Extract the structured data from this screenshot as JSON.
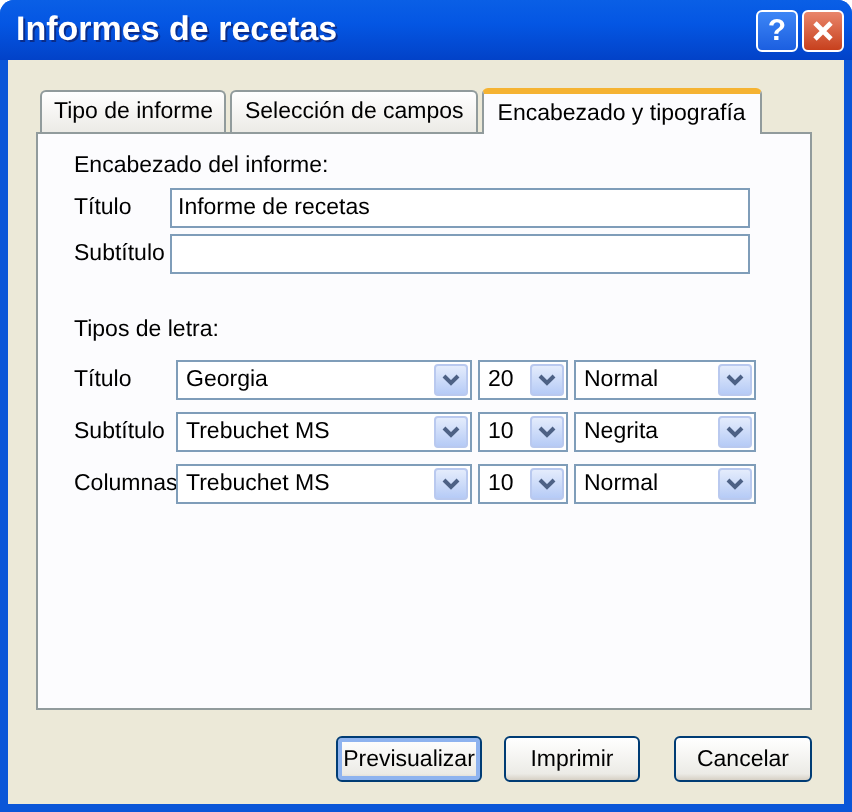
{
  "window": {
    "title": "Informes de recetas"
  },
  "title_buttons": [
    {
      "kind": "help",
      "label": "?"
    },
    {
      "kind": "close"
    }
  ],
  "tabs": [
    {
      "label": "Tipo de informe",
      "selected": false
    },
    {
      "label": "Selección de campos",
      "selected": false
    },
    {
      "label": "Encabezado y tipografía",
      "selected": true
    }
  ],
  "header_section": {
    "heading": "Encabezado del informe:",
    "fields": [
      {
        "label": "Título",
        "value": "Informe de recetas"
      },
      {
        "label": "Subtítulo"
      }
    ]
  },
  "fonts_section": {
    "heading": "Tipos de letra:",
    "rows": [
      {
        "label": "Título",
        "font": "Georgia",
        "size": "20",
        "style": "Normal"
      },
      {
        "label": "Subtítulo",
        "font": "Trebuchet MS",
        "size": "10",
        "style": "Negrita"
      },
      {
        "label": "Columnas",
        "font": "Trebuchet MS",
        "size": "10",
        "style": "Normal"
      }
    ]
  },
  "buttons": [
    {
      "label": "Previsualizar",
      "default": true
    },
    {
      "label": "Imprimir",
      "default": false
    },
    {
      "label": "Cancelar",
      "default": false
    }
  ]
}
